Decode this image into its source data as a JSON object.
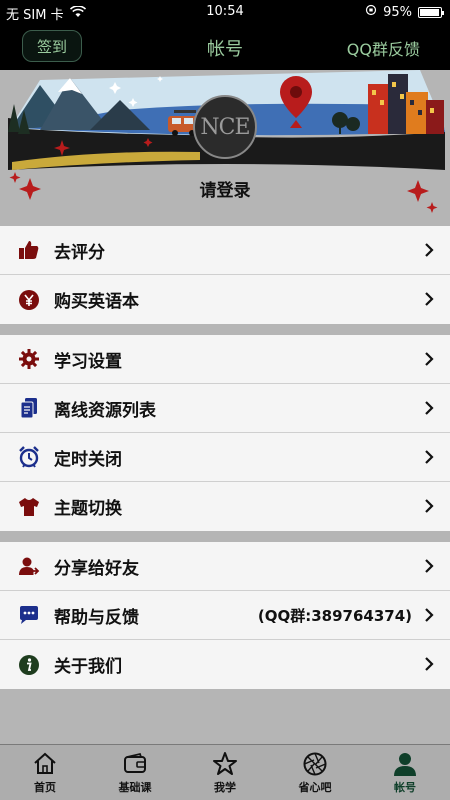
{
  "status_bar": {
    "carrier": "无 SIM 卡",
    "time": "10:54",
    "battery": "95%",
    "battery_level": 0.95
  },
  "nav": {
    "checkin_label": "签到",
    "title": "帐号",
    "right_label": "QQ群反馈"
  },
  "profile": {
    "avatar_text": "NCE",
    "login_label": "请登录"
  },
  "groups": [
    {
      "items": [
        {
          "label": "去评分",
          "icon": "thumbs-up-icon"
        },
        {
          "label": "购买英语本",
          "icon": "yen-coin-icon"
        }
      ]
    },
    {
      "items": [
        {
          "label": "学习设置",
          "icon": "gear-icon"
        },
        {
          "label": "离线资源列表",
          "icon": "documents-icon"
        },
        {
          "label": "定时关闭",
          "icon": "alarm-clock-icon"
        },
        {
          "label": "主题切换",
          "icon": "tshirt-icon"
        }
      ]
    },
    {
      "items": [
        {
          "label": "分享给好友",
          "icon": "share-user-icon"
        },
        {
          "label": "帮助与反馈",
          "icon": "chat-bubble-icon",
          "value": "(QQ群:389764374)"
        },
        {
          "label": "关于我们",
          "icon": "info-icon"
        }
      ]
    }
  ],
  "tabs": [
    {
      "label": "首页",
      "icon": "home-icon"
    },
    {
      "label": "基础课",
      "icon": "wallet-icon"
    },
    {
      "label": "我学",
      "icon": "star-icon"
    },
    {
      "label": "省心吧",
      "icon": "aperture-icon"
    },
    {
      "label": "帐号",
      "icon": "person-icon",
      "active": true
    }
  ],
  "colors": {
    "accent_green": "#9acb9e",
    "icon_red": "#7a0d0d",
    "icon_blue": "#1c2f8c"
  }
}
